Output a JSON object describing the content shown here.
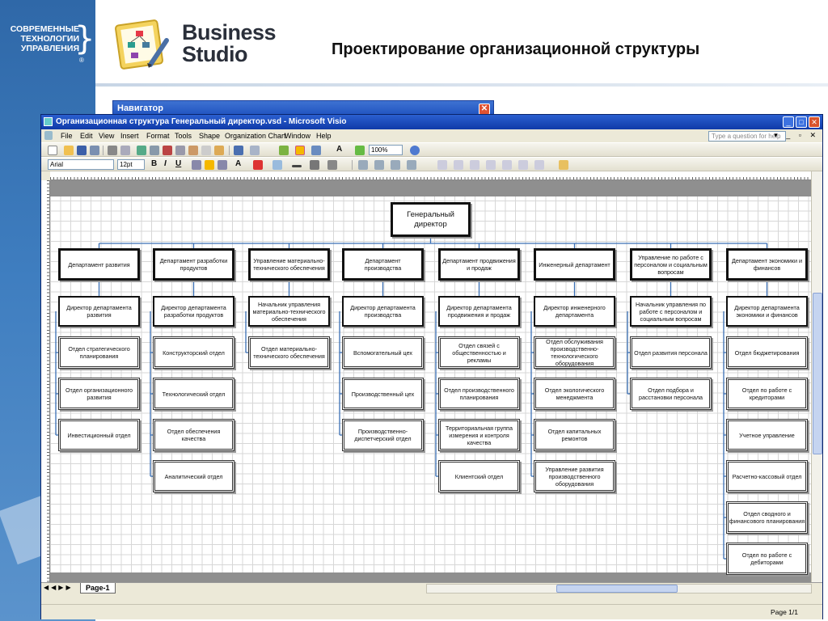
{
  "brand": {
    "line1": "СОВРЕМЕННЫЕ",
    "line2": "ТЕХНОЛОГИИ",
    "line3": "УПРАВЛЕНИЯ",
    "reg": "®"
  },
  "logo": {
    "line1": "Business",
    "line2": "Studio"
  },
  "slide_title": "Проектирование организационной структуры",
  "navigator": {
    "title": "Навигатор",
    "close": "✕"
  },
  "visio": {
    "title": "Организационная структура Генеральный директор.vsd - Microsoft Visio",
    "menu": [
      "File",
      "Edit",
      "View",
      "Insert",
      "Format",
      "Tools",
      "Shape",
      "Organization Chart",
      "Window",
      "Help"
    ],
    "help_placeholder": "Type a question for help",
    "font": "Arial",
    "font_size": "12pt",
    "zoom": "100%",
    "page_tab": "Page-1",
    "status_page": "Page 1/1"
  },
  "org": {
    "general": "Генеральный директор",
    "columns": [
      {
        "dept": "Департамент развития",
        "director": "Директор департамента развития",
        "units": [
          "Отдел стратегического планирования",
          "Отдел организационного развития",
          "Инвестиционный отдел"
        ]
      },
      {
        "dept": "Департамент разработки продуктов",
        "director": "Директор департамента разработки продуктов",
        "units": [
          "Конструкторский отдел",
          "Технологический отдел",
          "Отдел обеспечения качества",
          "Аналитический отдел"
        ]
      },
      {
        "dept": "Управление материально-технического обеспечения",
        "director": "Начальник управления материально-технического обеспечения",
        "units": [
          "Отдел материально-технического обеспечения"
        ]
      },
      {
        "dept": "Департамент производства",
        "director": "Директор департамента производства",
        "units": [
          "Вспомогательный цех",
          "Производственный цех",
          "Производственно-диспетчерский отдел"
        ]
      },
      {
        "dept": "Департамент продвижения и продаж",
        "director": "Директор департамента продвижения и продаж",
        "units": [
          "Отдел связей с общественностью и рекламы",
          "Отдел производственного планирования",
          "Территориальная группа измерения и контроля качества",
          "Клиентский отдел"
        ]
      },
      {
        "dept": "Инженерный департамент",
        "director": "Директор инженерного департамента",
        "units": [
          "Отдел обслуживания производственно-технологического оборудования",
          "Отдел экологического менеджмента",
          "Отдел капитальных ремонтов",
          "Управление развития производственного оборудования"
        ]
      },
      {
        "dept": "Управление по работе с персоналом и социальным вопросам",
        "director": "Начальник управления по работе с персоналом и социальным вопросам",
        "units": [
          "Отдел развития персонала",
          "Отдел подбора и расстановки персонала"
        ]
      },
      {
        "dept": "Департамент экономики и финансов",
        "director": "Директор департамента экономики и финансов",
        "units": [
          "Отдел бюджетирования",
          "Отдел по работе с кредиторами",
          "Учетное управление",
          "Расчетно-кассовый отдел",
          "Отдел сводного и финансового планирования",
          "Отдел по работе с дебиторами"
        ]
      }
    ]
  },
  "colors": {
    "connector": "#3a6fb5",
    "titlebar": "#1c4fbe",
    "brand_blue": "#2f68a8"
  }
}
